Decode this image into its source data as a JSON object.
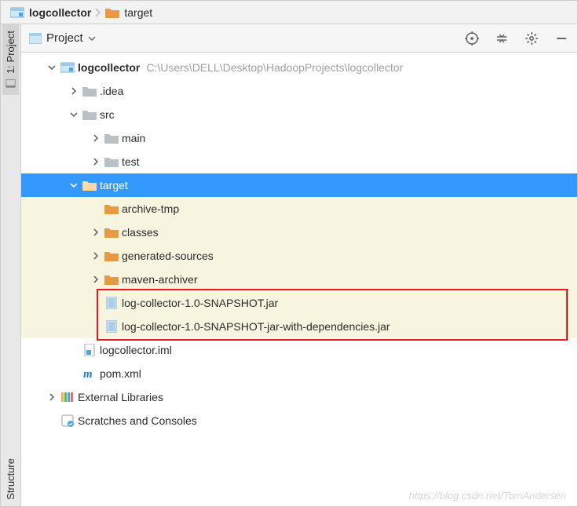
{
  "breadcrumb": [
    {
      "name": "logcollector",
      "icon": "module"
    },
    {
      "name": "target",
      "icon": "folder-orange"
    }
  ],
  "sidebar": {
    "tab_project": "1: Project",
    "tab_structure": "Structure"
  },
  "panel": {
    "title": "Project"
  },
  "colors": {
    "selection": "#3399ff",
    "highlight_bg": "#f7f4df",
    "annotation_box": "#e31b1b",
    "folder_orange": "#e69a43",
    "folder_grey": "#9aa1a8",
    "module_blue": "#4aa7e0"
  },
  "tree": [
    {
      "depth": 0,
      "arrow": "down",
      "icon": "module",
      "label": "logcollector",
      "bold": true,
      "path": "C:\\Users\\DELL\\Desktop\\HadoopProjects\\logcollector",
      "interact": true
    },
    {
      "depth": 1,
      "arrow": "right",
      "icon": "folder-grey",
      "label": ".idea",
      "interact": true
    },
    {
      "depth": 1,
      "arrow": "down",
      "icon": "folder-grey",
      "label": "src",
      "interact": true
    },
    {
      "depth": 2,
      "arrow": "right",
      "icon": "folder-grey",
      "label": "main",
      "interact": true
    },
    {
      "depth": 2,
      "arrow": "right",
      "icon": "folder-grey",
      "label": "test",
      "interact": true
    },
    {
      "depth": 1,
      "arrow": "down",
      "icon": "folder-orange",
      "label": "target",
      "selected": true,
      "interact": true
    },
    {
      "depth": 2,
      "arrow": "",
      "icon": "folder-orange",
      "label": "archive-tmp",
      "hl": true,
      "interact": true
    },
    {
      "depth": 2,
      "arrow": "right",
      "icon": "folder-orange",
      "label": "classes",
      "hl": true,
      "interact": true
    },
    {
      "depth": 2,
      "arrow": "right",
      "icon": "folder-orange",
      "label": "generated-sources",
      "hl": true,
      "interact": true
    },
    {
      "depth": 2,
      "arrow": "right",
      "icon": "folder-orange",
      "label": "maven-archiver",
      "hl": true,
      "interact": true
    },
    {
      "depth": 2,
      "arrow": "",
      "icon": "jar",
      "label": "log-collector-1.0-SNAPSHOT.jar",
      "hl": true,
      "box": true,
      "interact": true
    },
    {
      "depth": 2,
      "arrow": "",
      "icon": "jar",
      "label": "log-collector-1.0-SNAPSHOT-jar-with-dependencies.jar",
      "hl": true,
      "box": true,
      "interact": true
    },
    {
      "depth": 1,
      "arrow": "",
      "icon": "iml",
      "label": "logcollector.iml",
      "interact": true
    },
    {
      "depth": 1,
      "arrow": "",
      "icon": "maven",
      "label": "pom.xml",
      "interact": true
    },
    {
      "depth": 0,
      "arrow": "right",
      "icon": "library",
      "label": "External Libraries",
      "interact": true
    },
    {
      "depth": 0,
      "arrow": "",
      "icon": "scratch",
      "label": "Scratches and Consoles",
      "interact": true
    }
  ],
  "watermark": "https://blog.csdn.net/TomAndersen"
}
